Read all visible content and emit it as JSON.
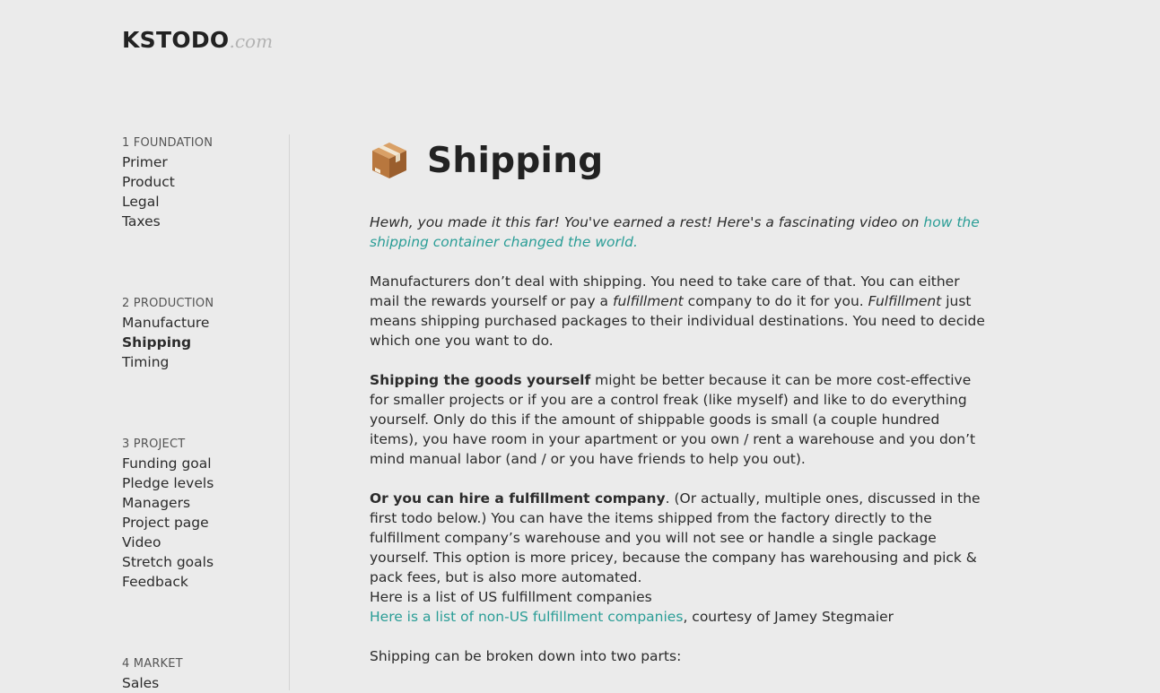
{
  "logo": {
    "main": "KSTODO",
    "suffix": ".com"
  },
  "sidebar": {
    "sections": [
      {
        "heading": "1 FOUNDATION",
        "items": [
          "Primer",
          "Product",
          "Legal",
          "Taxes"
        ]
      },
      {
        "heading": "2 PRODUCTION",
        "items": [
          "Manufacture",
          "Shipping",
          "Timing"
        ],
        "active": "Shipping"
      },
      {
        "heading": "3 PROJECT",
        "items": [
          "Funding goal",
          "Pledge levels",
          "Managers",
          "Project page",
          "Video",
          "Stretch goals",
          "Feedback"
        ]
      },
      {
        "heading": "4 MARKET",
        "items": [
          "Sales"
        ]
      }
    ]
  },
  "page": {
    "icon": "package-box-icon",
    "title": "Shipping",
    "intro": {
      "text": "Hewh, you made it this far! You've earned a rest! Here's a fascinating video on ",
      "link": "how the shipping container changed the world."
    },
    "p2": {
      "a": "Manufacturers don’t deal with shipping. You need to take care of that. You can either mail the rewards yourself or pay a ",
      "b_italic": "fulfillment",
      "c": " company to do it for you. ",
      "d_italic": "Fulfillment",
      "e": " just means shipping purchased packages to their individual destinations. You need to decide which one you want to do."
    },
    "p3": {
      "bold": "Shipping the goods yourself",
      "rest": " might be better because it can be more cost-effective for smaller projects or if you are a control freak (like myself) and like to do everything yourself. Only do this if the amount of shippable goods is small (a couple hundred items), you have room in your apartment or you own / rent a warehouse and you don’t mind manual labor (and / or you have friends to help you out)."
    },
    "p4": {
      "bold": "Or you can hire a fulfillment company",
      "rest": ". (Or actually, multiple ones, discussed in the first todo below.) You can have the items shipped from the factory directly to the fulfillment company’s warehouse and you will not see or handle a single package yourself. This option is more pricey, because the company has warehousing and pick & pack fees, but is also more automated.",
      "line2": "Here is a list of US fulfillment companies",
      "link3": "Here is a list of non-US fulfillment companies",
      "line3_rest": ", courtesy of Jamey Stegmaier"
    },
    "p5": "Shipping can be broken down into two parts:"
  },
  "colors": {
    "background": "#ebebeb",
    "link": "#2a9d96",
    "text": "#2b2b2b",
    "logo_suffix": "#b3b3b3"
  }
}
